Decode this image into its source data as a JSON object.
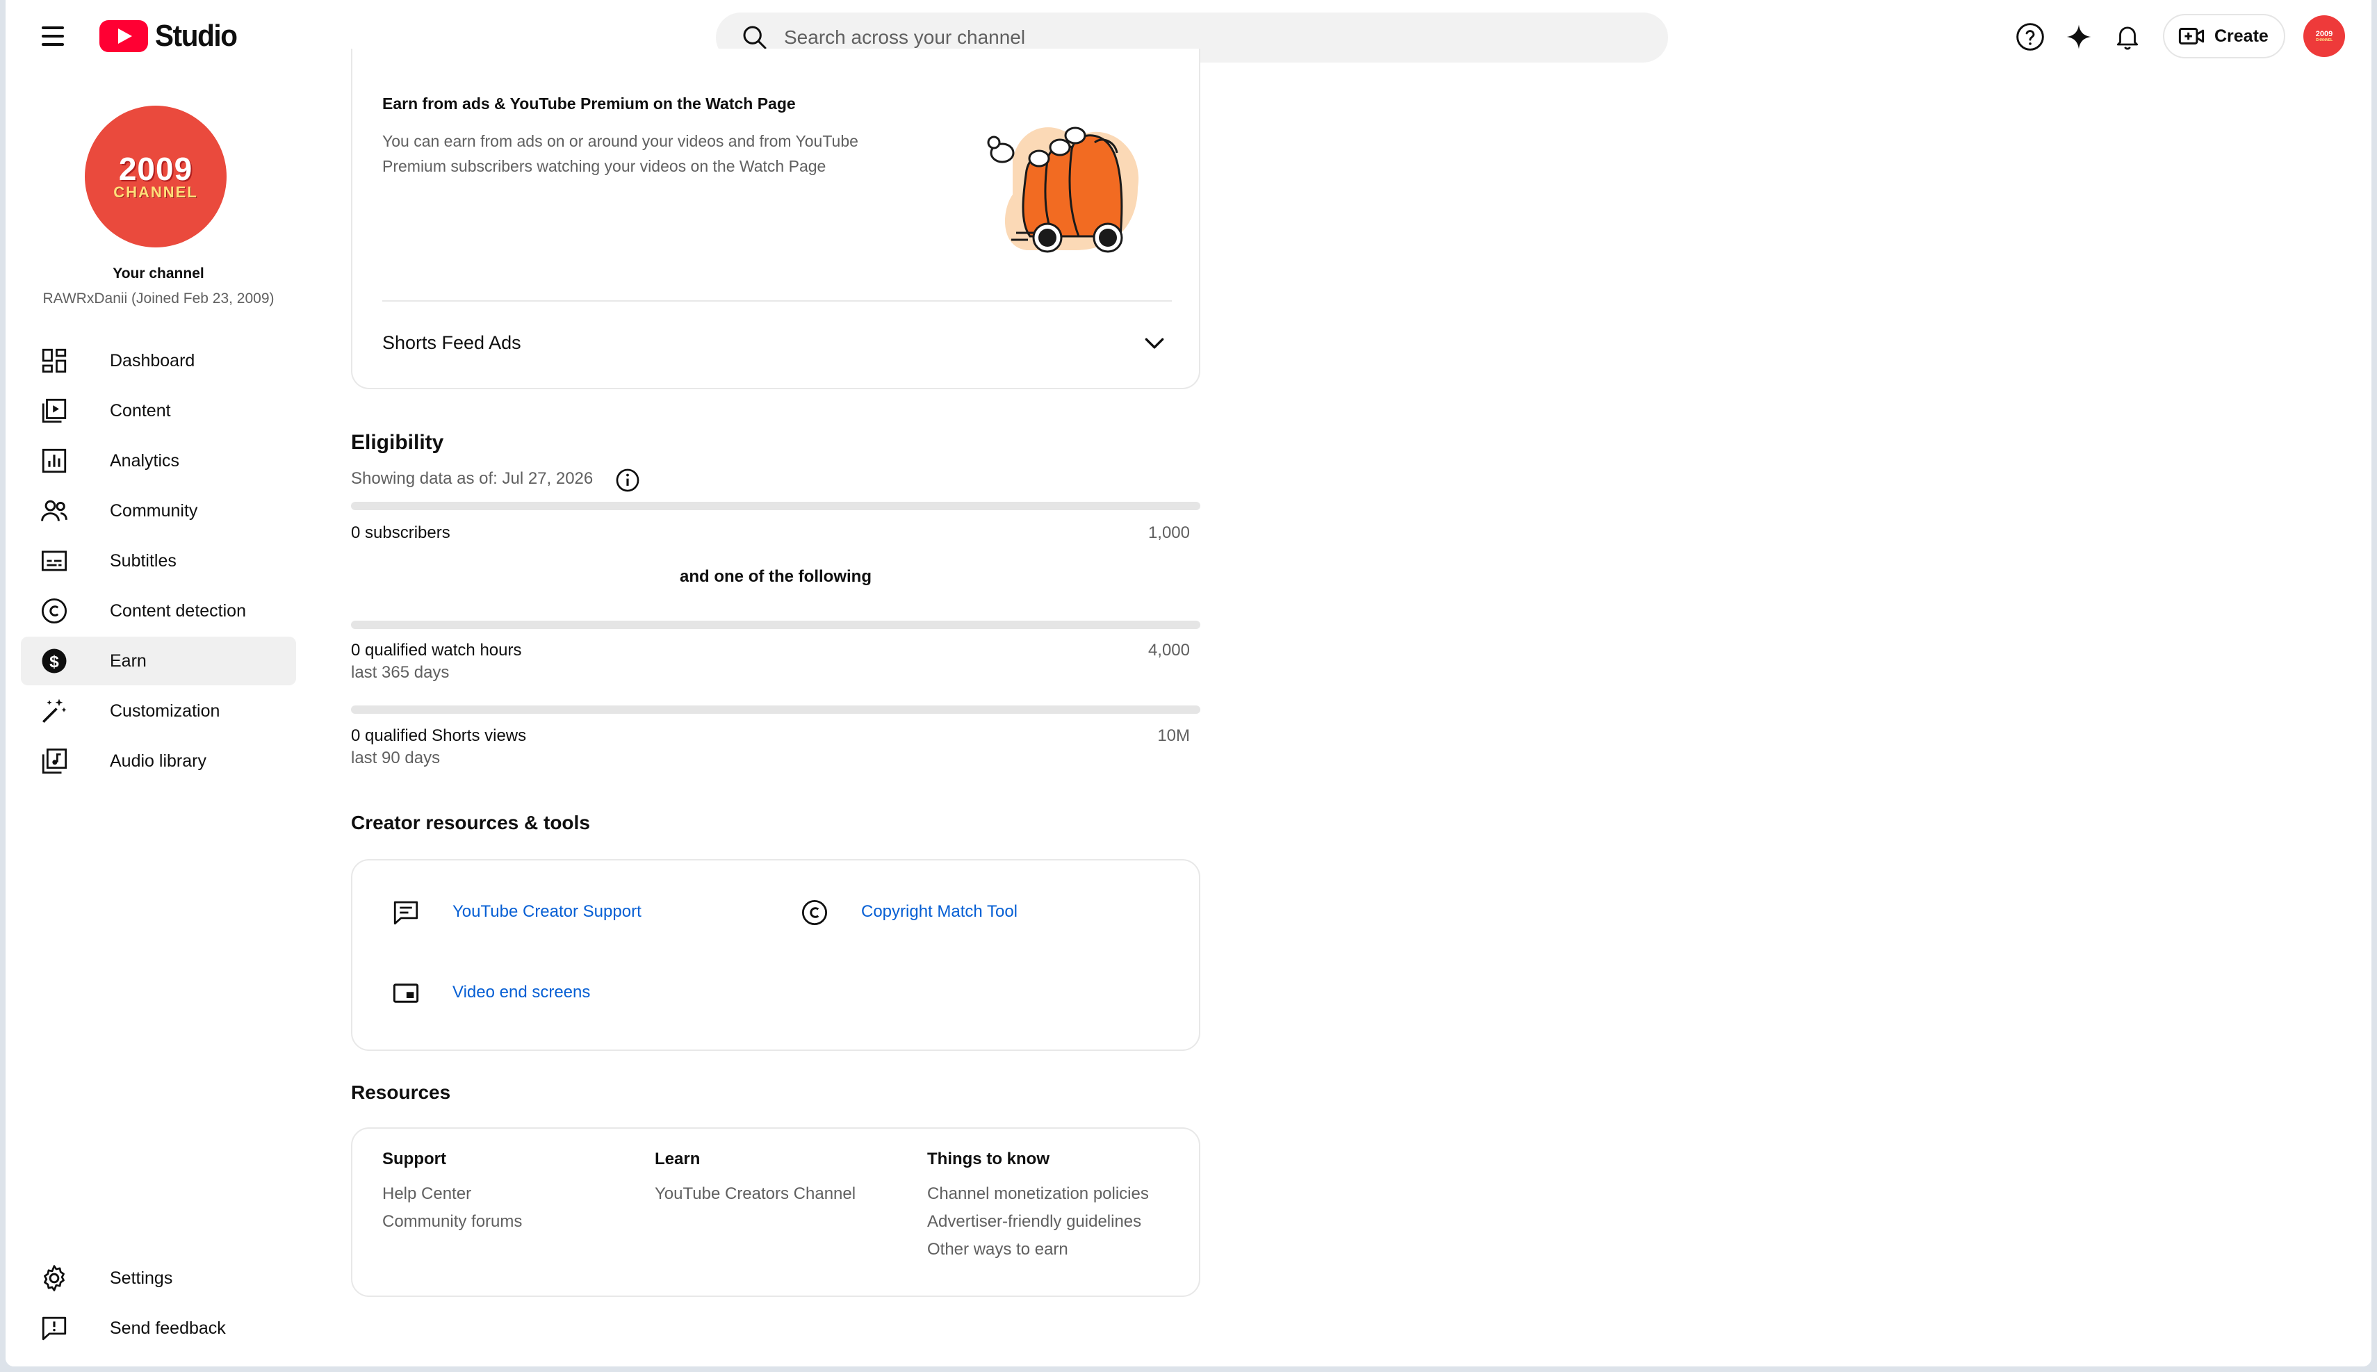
{
  "header": {
    "logo_text": "Studio",
    "search_placeholder": "Search across your channel",
    "create_label": "Create",
    "avatar_line1": "2009",
    "avatar_line2": "CHANNEL"
  },
  "channel": {
    "avatar_line1": "2009",
    "avatar_line2": "CHANNEL",
    "title": "Your channel",
    "subtitle": "RAWRxDanii (Joined Feb 23, 2009)"
  },
  "sidebar": {
    "items": [
      {
        "label": "Dashboard"
      },
      {
        "label": "Content"
      },
      {
        "label": "Analytics"
      },
      {
        "label": "Community"
      },
      {
        "label": "Subtitles"
      },
      {
        "label": "Content detection"
      },
      {
        "label": "Earn"
      },
      {
        "label": "Customization"
      },
      {
        "label": "Audio library"
      }
    ],
    "bottom": [
      {
        "label": "Settings"
      },
      {
        "label": "Send feedback"
      }
    ],
    "active_index": 6
  },
  "watch_page": {
    "title": "Earn from ads & YouTube Premium on the Watch Page",
    "description_line1": "You can earn from ads on or around your videos and from YouTube",
    "description_line2": "Premium subscribers watching your videos on the Watch Page",
    "shorts_label": "Shorts Feed Ads"
  },
  "eligibility": {
    "heading": "Eligibility",
    "as_of": "Showing data as of: Jul 27, 2026",
    "subscribers": {
      "label": "0 subscribers",
      "target": "1,000",
      "progress": 0
    },
    "connector": "and one of the following",
    "watch_hours": {
      "label": "0 qualified watch hours",
      "sub": "last 365 days",
      "target": "4,000",
      "progress": 0
    },
    "shorts_views": {
      "label": "0 qualified Shorts views",
      "sub": "last 90 days",
      "target": "10M",
      "progress": 0
    }
  },
  "creator_tools": {
    "heading": "Creator resources & tools",
    "links": [
      {
        "label": "YouTube Creator Support",
        "icon": "feedback-icon"
      },
      {
        "label": "Copyright Match Tool",
        "icon": "copyright-icon"
      },
      {
        "label": "Video end screens",
        "icon": "end-screen-icon"
      }
    ]
  },
  "resources": {
    "heading": "Resources",
    "columns": [
      {
        "title": "Support",
        "links": [
          "Help Center",
          "Community forums"
        ]
      },
      {
        "title": "Learn",
        "links": [
          "YouTube Creators Channel"
        ]
      },
      {
        "title": "Things to know",
        "links": [
          "Channel monetization policies",
          "Advertiser-friendly guidelines",
          "Other ways to earn"
        ]
      }
    ]
  },
  "colors": {
    "brand_red": "#ff0033",
    "link_blue": "#065fd4",
    "illustration_orange": "#f26b22"
  }
}
